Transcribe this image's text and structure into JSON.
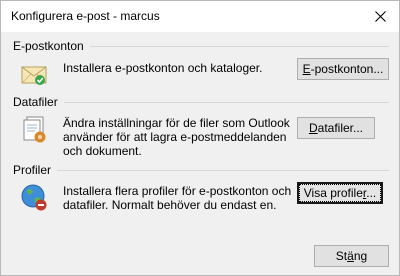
{
  "window": {
    "title": "Konfigurera e-post - marcus"
  },
  "sections": {
    "accounts": {
      "header": "E-postkonton",
      "description": "Installera e-postkonton och kataloger.",
      "button_mnemonic": "E",
      "button_rest": "-postkonton...",
      "icon": "mail-accounts-icon"
    },
    "datafiles": {
      "header": "Datafiler",
      "description_line1": "Ändra inställningar för de filer som Outlook",
      "description_line2": "använder för att lagra e-postmeddelanden",
      "description_line3": "och dokument.",
      "button_mnemonic": "D",
      "button_rest": "atafiler...",
      "icon": "data-files-icon"
    },
    "profiles": {
      "header": "Profiler",
      "description_line1": "Installera flera profiler för e-postkonton och",
      "description_line2": "datafiler. Normalt behöver du endast en.",
      "button_before": "Visa profile",
      "button_mnemonic": "r",
      "button_after": "...",
      "icon": "profiles-globe-icon"
    }
  },
  "footer": {
    "close_before": "St",
    "close_mnemonic": "ä",
    "close_after": "ng"
  }
}
